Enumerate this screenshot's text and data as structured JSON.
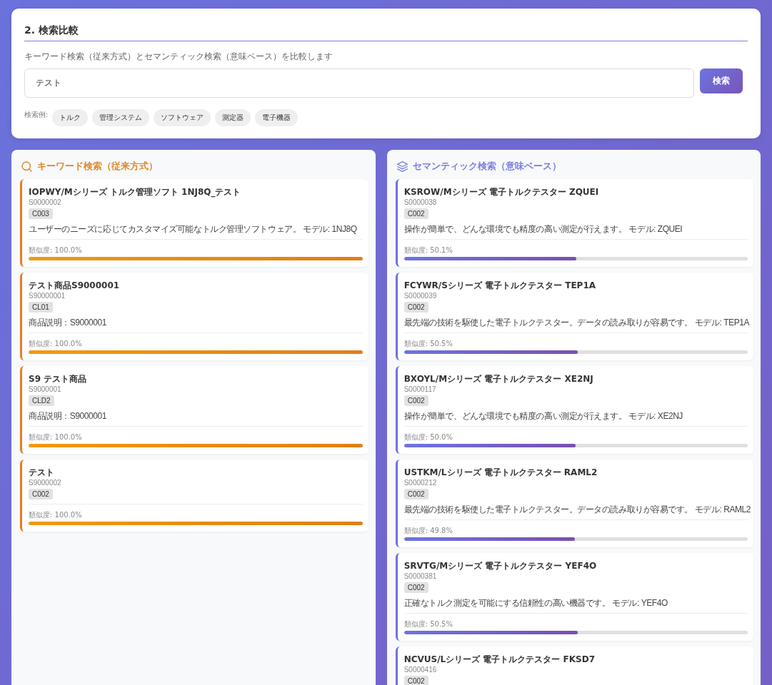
{
  "section": {
    "title": "2. 検索比較",
    "description": "キーワード検索（従来方式）とセマンティック検索（意味ベース）を比較します",
    "search": {
      "value": "テスト",
      "button": "検索"
    },
    "examples_label": "検索例:",
    "examples": [
      "トルク",
      "管理システム",
      "ソフトウェア",
      "測定器",
      "電子機器"
    ]
  },
  "columns": [
    {
      "kind": "keyword",
      "title": "キーワード検索（従来方式）",
      "results": [
        {
          "name": "IOPWY/Mシリーズ トルク管理ソフト 1NJ8Q_テスト",
          "code": "S0000002",
          "category": "C003",
          "description": "ユーザーのニーズに応じてカスタマイズ可能なトルク管理ソフトウェア。 モデル: 1NJ8Q",
          "similarity": "類似度: 100.0%",
          "level": 1.0
        },
        {
          "name": "テスト商品S9000001",
          "code": "S90000001",
          "category": "CL01",
          "description": "商品説明：S9000001",
          "similarity": "類似度: 100.0%",
          "level": 1.0
        },
        {
          "name": "S9 テスト商品",
          "code": "S9000001",
          "category": "CLD2",
          "description": "商品説明：S9000001",
          "similarity": "類似度: 100.0%",
          "level": 1.0
        },
        {
          "name": "テスト",
          "code": "S9000002",
          "category": "C002",
          "similarity": "類似度: 100.0%",
          "level": 1.0
        }
      ]
    },
    {
      "kind": "semantic",
      "title": "セマンティック検索（意味ベース）",
      "results": [
        {
          "name": "KSROW/Mシリーズ 電子トルクテスター ZQUEI",
          "code": "S0000038",
          "category": "C002",
          "description": "操作が簡単で、どんな環境でも精度の高い測定が行えます。 モデル: ZQUEI",
          "similarity": "類似度: 50.1%",
          "level": 0.501
        },
        {
          "name": "FCYWR/Sシリーズ 電子トルクテスター TEP1A",
          "code": "S0000039",
          "category": "C002",
          "description": "最先端の技術を駆使した電子トルクテスター。データの読み取りが容易です。 モデル: TEP1A",
          "similarity": "類似度: 50.5%",
          "level": 0.505
        },
        {
          "name": "BXOYL/Mシリーズ 電子トルクテスター XE2NJ",
          "code": "S0000117",
          "category": "C002",
          "description": "操作が簡単で、どんな環境でも精度の高い測定が行えます。 モデル: XE2NJ",
          "similarity": "類似度: 50.0%",
          "level": 0.5
        },
        {
          "name": "USTKM/Lシリーズ 電子トルクテスター RAML2",
          "code": "S0000212",
          "category": "C002",
          "description": "最先端の技術を駆使した電子トルクテスター。データの読み取りが容易です。 モデル: RAML2",
          "similarity": "類似度: 49.8%",
          "level": 0.498
        },
        {
          "name": "SRVTG/Mシリーズ 電子トルクテスター YEF4O",
          "code": "S0000381",
          "category": "C002",
          "description": "正確なトルク測定を可能にする信頼性の高い機器です。 モデル: YEF4O",
          "similarity": "類似度: 50.5%",
          "level": 0.505
        },
        {
          "name": "NCVUS/Lシリーズ 電子トルクテスター FKSD7",
          "code": "S0000416",
          "category": "C002"
        }
      ]
    }
  ]
}
